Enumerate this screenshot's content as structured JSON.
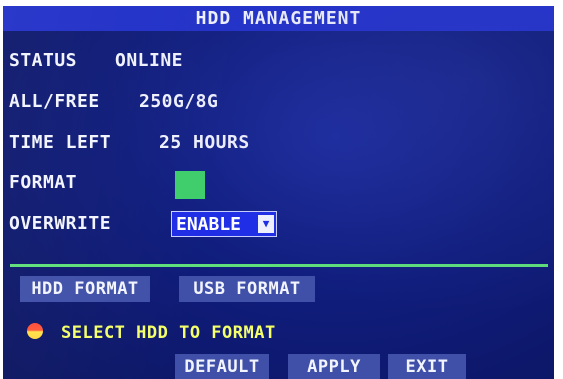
{
  "title": "HDD MANAGEMENT",
  "rows": {
    "status": {
      "label": "STATUS",
      "value": "ONLINE"
    },
    "all_free": {
      "label": "ALL/FREE",
      "value": "250G/8G"
    },
    "time_left": {
      "label": "TIME LEFT",
      "value": "25 HOURS"
    },
    "format": {
      "label": "FORMAT"
    },
    "overwrite": {
      "label": "OVERWRITE",
      "value": "ENABLE"
    }
  },
  "buttons": {
    "hdd_format": "HDD FORMAT",
    "usb_format": "USB FORMAT",
    "default": "DEFAULT",
    "apply": "APPLY",
    "exit": "EXIT"
  },
  "message": "SELECT HDD TO FORMAT",
  "colors": {
    "screen_bg": "#101d7c",
    "titlebar": "#2231c8",
    "button": "#4050a8",
    "divider": "#5fe07a",
    "format_swatch": "#3fd06a",
    "message_text": "#f4ff6a"
  },
  "icons": {
    "select_arrow": "triangle-down-icon",
    "message_indicator": "status-dot-icon"
  }
}
